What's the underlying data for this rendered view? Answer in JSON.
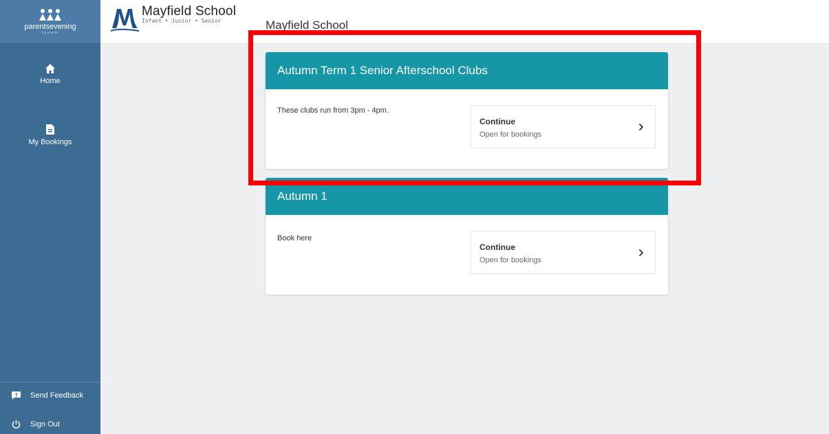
{
  "sidebar": {
    "brand_name": "parentsevening",
    "brand_sub": "system",
    "nav": [
      {
        "label": "Home",
        "icon": "home-icon"
      },
      {
        "label": "My Bookings",
        "icon": "document-icon"
      }
    ],
    "footer": [
      {
        "label": "Send Feedback",
        "icon": "feedback-icon"
      },
      {
        "label": "Sign Out",
        "icon": "power-icon"
      }
    ]
  },
  "header": {
    "logo_name": "Mayfield School",
    "logo_sub": "Infant • Junior • Senior",
    "page_title": "Mayfield School"
  },
  "events": [
    {
      "title": "Autumn Term 1 Senior Afterschool Clubs",
      "description": "These clubs run from 3pm - 4pm.",
      "action_label": "Continue",
      "status": "Open for bookings"
    },
    {
      "title": "Autumn 1",
      "description": "Book here",
      "action_label": "Continue",
      "status": "Open for bookings"
    }
  ],
  "colors": {
    "sidebar": "#3c6b94",
    "card_header": "#1597a8",
    "highlight": "#ff0000"
  }
}
